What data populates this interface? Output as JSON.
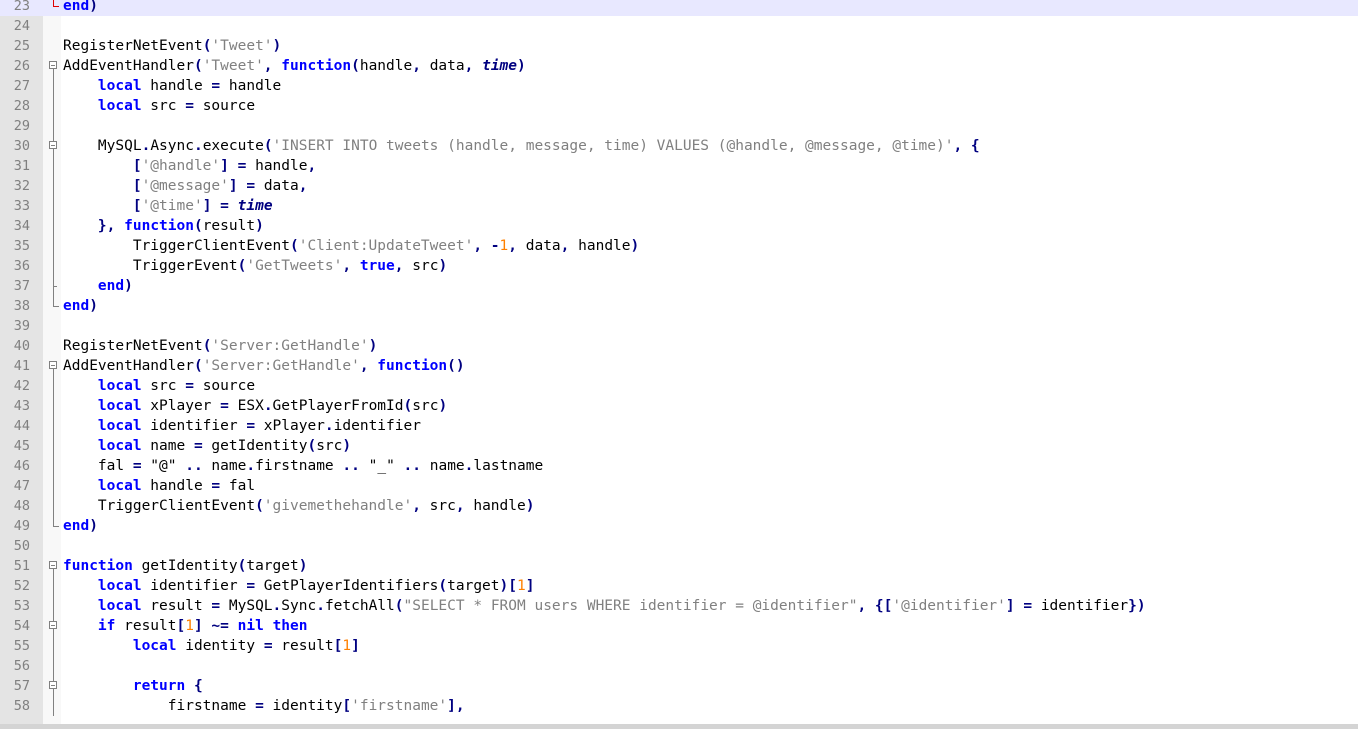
{
  "editor": {
    "lines": [
      {
        "n": "23",
        "fold": "end-red",
        "current": true,
        "tokens": [
          [
            "kw",
            "end"
          ],
          [
            "op",
            ")"
          ]
        ]
      },
      {
        "n": "24",
        "fold": "none",
        "tokens": []
      },
      {
        "n": "25",
        "fold": "none",
        "tokens": [
          [
            "",
            "RegisterNetEvent"
          ],
          [
            "op",
            "("
          ],
          [
            "str",
            "'Tweet'"
          ],
          [
            "op",
            ")"
          ]
        ]
      },
      {
        "n": "26",
        "fold": "open",
        "tokens": [
          [
            "",
            "AddEventHandler"
          ],
          [
            "op",
            "("
          ],
          [
            "str",
            "'Tweet'"
          ],
          [
            "op",
            ", "
          ],
          [
            "kw",
            "function"
          ],
          [
            "op",
            "("
          ],
          [
            "",
            "handle"
          ],
          [
            "op",
            ", "
          ],
          [
            "",
            "data"
          ],
          [
            "op",
            ", "
          ],
          [
            "it",
            "time"
          ],
          [
            "op",
            ")"
          ]
        ]
      },
      {
        "n": "27",
        "fold": "line",
        "tokens": [
          [
            "",
            "    "
          ],
          [
            "kw",
            "local"
          ],
          [
            "",
            " handle "
          ],
          [
            "op",
            "="
          ],
          [
            "",
            " handle"
          ]
        ]
      },
      {
        "n": "28",
        "fold": "line",
        "tokens": [
          [
            "",
            "    "
          ],
          [
            "kw",
            "local"
          ],
          [
            "",
            " src "
          ],
          [
            "op",
            "="
          ],
          [
            "",
            " source"
          ]
        ]
      },
      {
        "n": "29",
        "fold": "line",
        "tokens": []
      },
      {
        "n": "30",
        "fold": "open-inner",
        "tokens": [
          [
            "",
            "    MySQL"
          ],
          [
            "op",
            "."
          ],
          [
            "",
            "Async"
          ],
          [
            "op",
            "."
          ],
          [
            "",
            "execute"
          ],
          [
            "op",
            "("
          ],
          [
            "str",
            "'INSERT INTO tweets (handle, message, time) VALUES (@handle, @message, @time)'"
          ],
          [
            "op",
            ", {"
          ]
        ]
      },
      {
        "n": "31",
        "fold": "line",
        "tokens": [
          [
            "",
            "        "
          ],
          [
            "op",
            "["
          ],
          [
            "str",
            "'@handle'"
          ],
          [
            "op",
            "] ="
          ],
          [
            "",
            " handle"
          ],
          [
            "op",
            ","
          ]
        ]
      },
      {
        "n": "32",
        "fold": "line",
        "tokens": [
          [
            "",
            "        "
          ],
          [
            "op",
            "["
          ],
          [
            "str",
            "'@message'"
          ],
          [
            "op",
            "] ="
          ],
          [
            "",
            " data"
          ],
          [
            "op",
            ","
          ]
        ]
      },
      {
        "n": "33",
        "fold": "line",
        "tokens": [
          [
            "",
            "        "
          ],
          [
            "op",
            "["
          ],
          [
            "str",
            "'@time'"
          ],
          [
            "op",
            "] ="
          ],
          [
            "",
            " "
          ],
          [
            "it",
            "time"
          ]
        ]
      },
      {
        "n": "34",
        "fold": "line",
        "tokens": [
          [
            "",
            "    "
          ],
          [
            "op",
            "}, "
          ],
          [
            "kw",
            "function"
          ],
          [
            "op",
            "("
          ],
          [
            "",
            "result"
          ],
          [
            "op",
            ")"
          ]
        ]
      },
      {
        "n": "35",
        "fold": "line",
        "tokens": [
          [
            "",
            "        TriggerClientEvent"
          ],
          [
            "op",
            "("
          ],
          [
            "str",
            "'Client:UpdateTweet'"
          ],
          [
            "op",
            ", -"
          ],
          [
            "num",
            "1"
          ],
          [
            "op",
            ", "
          ],
          [
            "",
            "data"
          ],
          [
            "op",
            ", "
          ],
          [
            "",
            "handle"
          ],
          [
            "op",
            ")"
          ]
        ]
      },
      {
        "n": "36",
        "fold": "line",
        "tokens": [
          [
            "",
            "        TriggerEvent"
          ],
          [
            "op",
            "("
          ],
          [
            "str",
            "'GetTweets'"
          ],
          [
            "op",
            ", "
          ],
          [
            "kw",
            "true"
          ],
          [
            "op",
            ", "
          ],
          [
            "",
            "src"
          ],
          [
            "op",
            ")"
          ]
        ]
      },
      {
        "n": "37",
        "fold": "tick",
        "tokens": [
          [
            "",
            "    "
          ],
          [
            "kw",
            "end"
          ],
          [
            "op",
            ")"
          ]
        ]
      },
      {
        "n": "38",
        "fold": "end",
        "tokens": [
          [
            "kw",
            "end"
          ],
          [
            "op",
            ")"
          ]
        ]
      },
      {
        "n": "39",
        "fold": "none",
        "tokens": []
      },
      {
        "n": "40",
        "fold": "none",
        "tokens": [
          [
            "",
            "RegisterNetEvent"
          ],
          [
            "op",
            "("
          ],
          [
            "str",
            "'Server:GetHandle'"
          ],
          [
            "op",
            ")"
          ]
        ]
      },
      {
        "n": "41",
        "fold": "open",
        "tokens": [
          [
            "",
            "AddEventHandler"
          ],
          [
            "op",
            "("
          ],
          [
            "str",
            "'Server:GetHandle'"
          ],
          [
            "op",
            ", "
          ],
          [
            "kw",
            "function"
          ],
          [
            "op",
            "()"
          ]
        ]
      },
      {
        "n": "42",
        "fold": "line",
        "tokens": [
          [
            "",
            "    "
          ],
          [
            "kw",
            "local"
          ],
          [
            "",
            " src "
          ],
          [
            "op",
            "="
          ],
          [
            "",
            " source"
          ]
        ]
      },
      {
        "n": "43",
        "fold": "line",
        "tokens": [
          [
            "",
            "    "
          ],
          [
            "kw",
            "local"
          ],
          [
            "",
            " xPlayer "
          ],
          [
            "op",
            "="
          ],
          [
            "",
            " ESX"
          ],
          [
            "op",
            "."
          ],
          [
            "",
            "GetPlayerFromId"
          ],
          [
            "op",
            "("
          ],
          [
            "",
            "src"
          ],
          [
            "op",
            ")"
          ]
        ]
      },
      {
        "n": "44",
        "fold": "line",
        "tokens": [
          [
            "",
            "    "
          ],
          [
            "kw",
            "local"
          ],
          [
            "",
            " identifier "
          ],
          [
            "op",
            "="
          ],
          [
            "",
            " xPlayer"
          ],
          [
            "op",
            "."
          ],
          [
            "",
            "identifier"
          ]
        ]
      },
      {
        "n": "45",
        "fold": "line",
        "tokens": [
          [
            "",
            "    "
          ],
          [
            "kw",
            "local"
          ],
          [
            "",
            " name "
          ],
          [
            "op",
            "="
          ],
          [
            "",
            " getIdentity"
          ],
          [
            "op",
            "("
          ],
          [
            "",
            "src"
          ],
          [
            "op",
            ")"
          ]
        ]
      },
      {
        "n": "46",
        "fold": "line",
        "tokens": [
          [
            "",
            "    fal "
          ],
          [
            "op",
            "="
          ],
          [
            "",
            " \"@\" "
          ],
          [
            "op",
            ".."
          ],
          [
            "",
            " name"
          ],
          [
            "op",
            "."
          ],
          [
            "",
            "firstname "
          ],
          [
            "op",
            ".."
          ],
          [
            "",
            " \"_\" "
          ],
          [
            "op",
            ".."
          ],
          [
            "",
            " name"
          ],
          [
            "op",
            "."
          ],
          [
            "",
            "lastname"
          ]
        ]
      },
      {
        "n": "47",
        "fold": "line",
        "tokens": [
          [
            "",
            "    "
          ],
          [
            "kw",
            "local"
          ],
          [
            "",
            " handle "
          ],
          [
            "op",
            "="
          ],
          [
            "",
            " fal"
          ]
        ]
      },
      {
        "n": "48",
        "fold": "line",
        "tokens": [
          [
            "",
            "    TriggerClientEvent"
          ],
          [
            "op",
            "("
          ],
          [
            "str",
            "'givemethehandle'"
          ],
          [
            "op",
            ", "
          ],
          [
            "",
            "src"
          ],
          [
            "op",
            ", "
          ],
          [
            "",
            "handle"
          ],
          [
            "op",
            ")"
          ]
        ]
      },
      {
        "n": "49",
        "fold": "end",
        "tokens": [
          [
            "kw",
            "end"
          ],
          [
            "op",
            ")"
          ]
        ]
      },
      {
        "n": "50",
        "fold": "none",
        "tokens": []
      },
      {
        "n": "51",
        "fold": "open",
        "tokens": [
          [
            "kw",
            "function"
          ],
          [
            "",
            " getIdentity"
          ],
          [
            "op",
            "("
          ],
          [
            "",
            "target"
          ],
          [
            "op",
            ")"
          ]
        ]
      },
      {
        "n": "52",
        "fold": "line",
        "tokens": [
          [
            "",
            "    "
          ],
          [
            "kw",
            "local"
          ],
          [
            "",
            " identifier "
          ],
          [
            "op",
            "="
          ],
          [
            "",
            " GetPlayerIdentifiers"
          ],
          [
            "op",
            "("
          ],
          [
            "",
            "target"
          ],
          [
            "op",
            ")["
          ],
          [
            "num",
            "1"
          ],
          [
            "op",
            "]"
          ]
        ]
      },
      {
        "n": "53",
        "fold": "line",
        "tokens": [
          [
            "",
            "    "
          ],
          [
            "kw",
            "local"
          ],
          [
            "",
            " result "
          ],
          [
            "op",
            "="
          ],
          [
            "",
            " MySQL"
          ],
          [
            "op",
            "."
          ],
          [
            "",
            "Sync"
          ],
          [
            "op",
            "."
          ],
          [
            "",
            "fetchAll"
          ],
          [
            "op",
            "("
          ],
          [
            "str",
            "\"SELECT * FROM users WHERE identifier = @identifier\""
          ],
          [
            "op",
            ", {["
          ],
          [
            "str",
            "'@identifier'"
          ],
          [
            "op",
            "] ="
          ],
          [
            "",
            " identifier"
          ],
          [
            "op",
            "})"
          ]
        ]
      },
      {
        "n": "54",
        "fold": "open-inner",
        "tokens": [
          [
            "",
            "    "
          ],
          [
            "kw",
            "if"
          ],
          [
            "",
            " result"
          ],
          [
            "op",
            "["
          ],
          [
            "num",
            "1"
          ],
          [
            "op",
            "] ~="
          ],
          [
            "",
            " "
          ],
          [
            "kw",
            "nil"
          ],
          [
            "",
            " "
          ],
          [
            "kw",
            "then"
          ]
        ]
      },
      {
        "n": "55",
        "fold": "line",
        "tokens": [
          [
            "",
            "        "
          ],
          [
            "kw",
            "local"
          ],
          [
            "",
            " identity "
          ],
          [
            "op",
            "="
          ],
          [
            "",
            " result"
          ],
          [
            "op",
            "["
          ],
          [
            "num",
            "1"
          ],
          [
            "op",
            "]"
          ]
        ]
      },
      {
        "n": "56",
        "fold": "line",
        "tokens": []
      },
      {
        "n": "57",
        "fold": "open-inner",
        "tokens": [
          [
            "",
            "        "
          ],
          [
            "kw",
            "return"
          ],
          [
            "",
            " "
          ],
          [
            "op",
            "{"
          ]
        ]
      },
      {
        "n": "58",
        "fold": "line",
        "tokens": [
          [
            "",
            "            firstname "
          ],
          [
            "op",
            "="
          ],
          [
            "",
            " identity"
          ],
          [
            "op",
            "["
          ],
          [
            "str",
            "'firstname'"
          ],
          [
            "op",
            "],"
          ]
        ]
      }
    ]
  }
}
